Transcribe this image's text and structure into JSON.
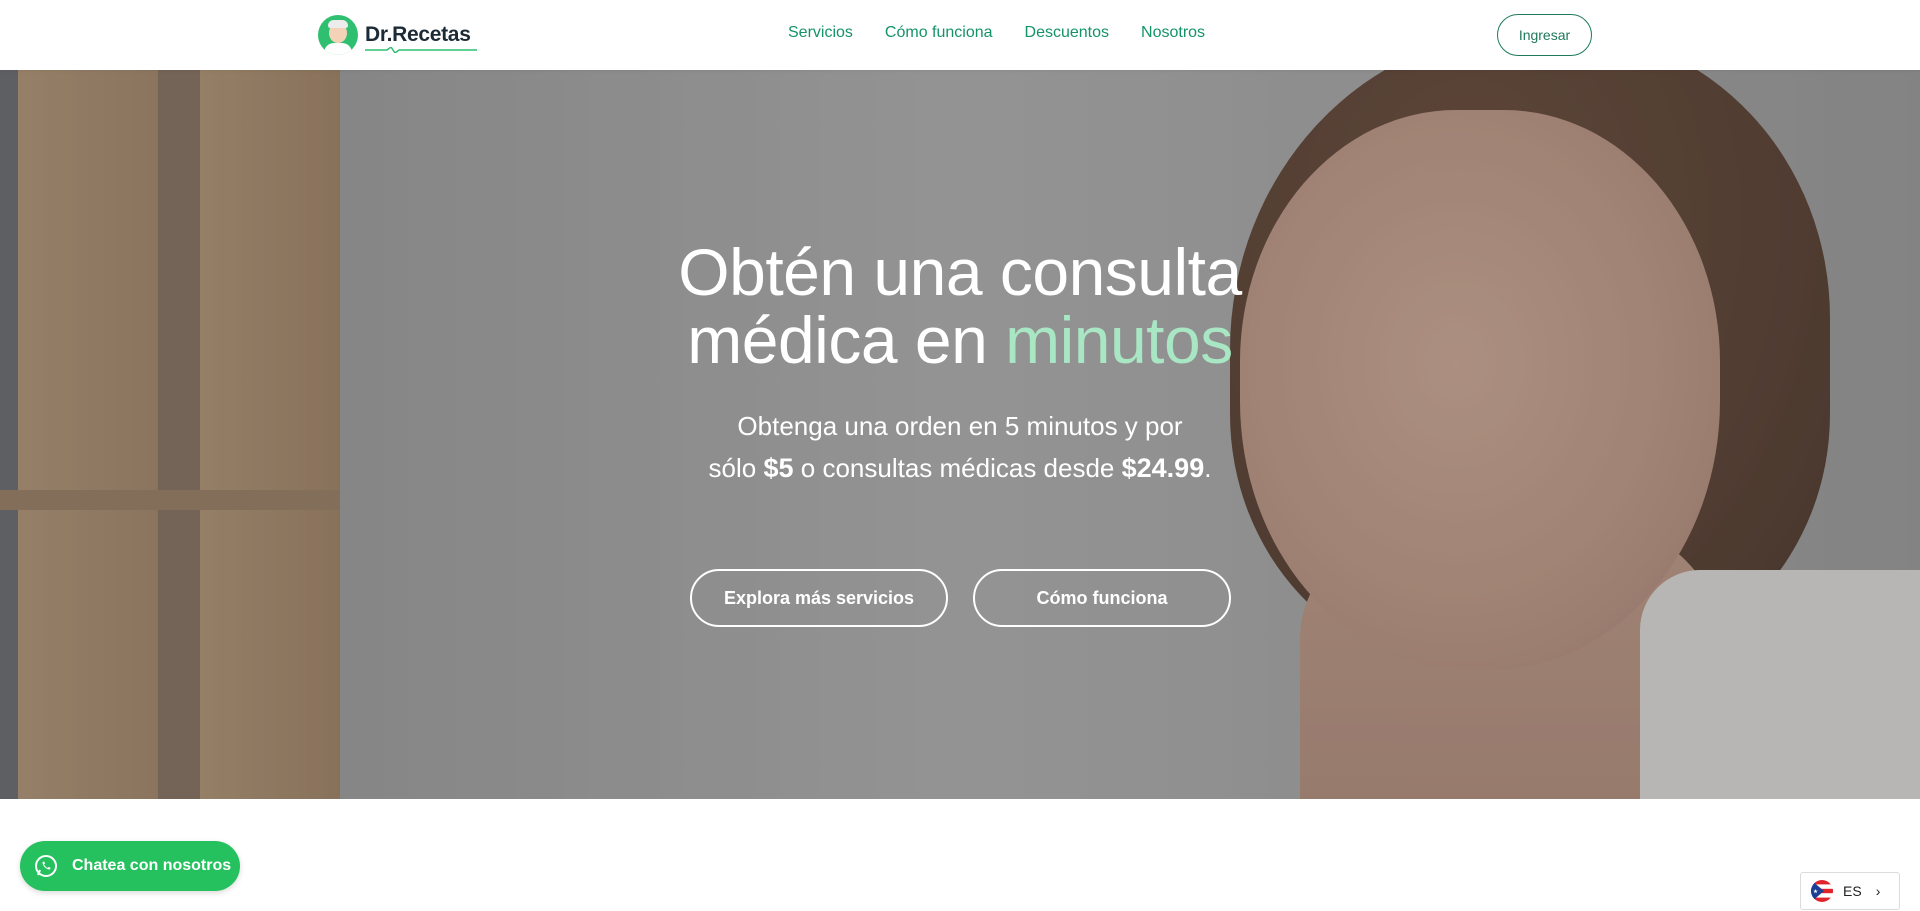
{
  "brand": {
    "name": "Dr.Recetas"
  },
  "nav": {
    "items": [
      {
        "label": "Servicios"
      },
      {
        "label": "Cómo funciona"
      },
      {
        "label": "Descuentos"
      },
      {
        "label": "Nosotros"
      }
    ],
    "login_label": "Ingresar"
  },
  "hero": {
    "title_line1": "Obtén una consulta",
    "title_line2_prefix": "médica en",
    "title_line2_accent": "minutos",
    "sub_line1": "Obtenga una orden en 5 minutos y por",
    "sub_pre": "sólo",
    "sub_price1": "$5",
    "sub_mid": "o consultas médicas desde",
    "sub_price2": "$24.99",
    "sub_end": ".",
    "btn_explore": "Explora más servicios",
    "btn_how": "Cómo funciona"
  },
  "chat": {
    "label": "Chatea con nosotros"
  },
  "language": {
    "code": "ES"
  },
  "colors": {
    "brand_green": "#14936b",
    "accent_mint": "#a8e6c4",
    "whatsapp_green": "#25c15e"
  }
}
